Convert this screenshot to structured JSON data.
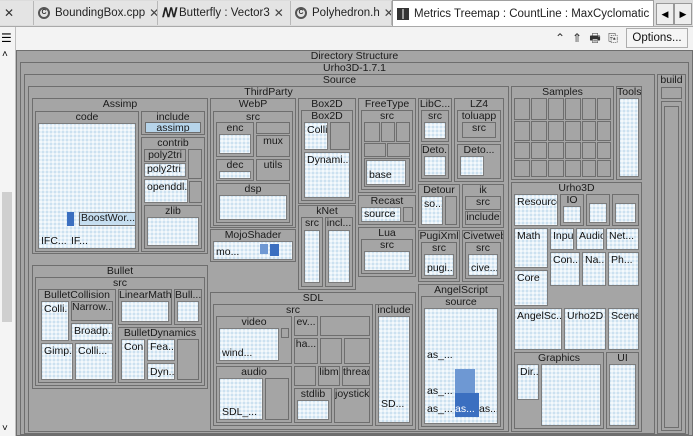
{
  "tabs": [
    {
      "label": "BoundingBox.cpp",
      "icon": "cpp-file-icon",
      "left": 0,
      "width": 34
    },
    {
      "label": "BoundingBox.cpp"
    },
    {
      "label": "Butterfly : Vector3"
    },
    {
      "label": "Polyhedron.h"
    },
    {
      "label": "Metrics Treemap : CountLine : MaxCyclomatic"
    }
  ],
  "toolbar": {
    "options_label": "Options..."
  },
  "treemap": {
    "root": "Directory Structure",
    "project": "Urho3D-1.7.1",
    "source": "Source",
    "thirdparty": "ThirdParty",
    "build": "build",
    "assimp": {
      "label": "Assimp",
      "code": "code",
      "include": "include",
      "assimp": "assimp",
      "contrib": "contrib",
      "poly2tri_a": "poly2tri",
      "poly2tri_b": "poly2tri",
      "openddl": "openddl...",
      "zlib": "zlib",
      "boostwor": "BoostWor...",
      "ifc1": "IFC...",
      "ifc2": "IF..."
    },
    "webp": {
      "label": "WebP",
      "src": "src",
      "enc": "enc",
      "mux": "mux",
      "dec": "dec",
      "utils": "utils",
      "dsp": "dsp"
    },
    "box2d": {
      "label": "Box2D",
      "inner": "Box2D",
      "colli": "Colli...",
      "dynami": "Dynami..."
    },
    "freetype": {
      "label": "FreeType",
      "src": "src",
      "base": "base"
    },
    "libc": {
      "label": "LibC...",
      "src": "src",
      "deto": "Deto..."
    },
    "lz4": {
      "label": "LZ4",
      "toluapp": "toluapp",
      "src": "src",
      "deto": "Deto..."
    },
    "recast": {
      "label": "Recast",
      "source": "source"
    },
    "detour": {
      "label": "Detour",
      "so": "so..."
    },
    "ik": {
      "label": "ik",
      "src": "src",
      "include": "include"
    },
    "knet": {
      "label": "kNet",
      "src": "src",
      "incl": "incl..."
    },
    "mojoshader": {
      "label": "MojoShader",
      "mo": "mo..."
    },
    "lua": {
      "label": "Lua",
      "src": "src"
    },
    "pugixml": {
      "label": "PugiXml",
      "src": "src",
      "pugi": "pugi..."
    },
    "civetweb": {
      "label": "Civetweb",
      "src": "src",
      "cive": "cive..."
    },
    "samples": {
      "label": "Samples"
    },
    "tools": {
      "label": "Tools"
    },
    "urho3d": {
      "label": "Urho3D",
      "resource": "Resource",
      "io": "IO",
      "math": "Math",
      "input": "Input",
      "audio": "Audio",
      "net": "Net...",
      "core": "Core",
      "con": "Con...",
      "na": "Na...",
      "ph": "Ph...",
      "angelsc": "AngelSc...",
      "urho2d": "Urho2D",
      "scene": "Scene",
      "graphics": "Graphics",
      "dir": "Dir...",
      "ui": "UI"
    },
    "bullet": {
      "label": "Bullet",
      "src": "src",
      "collision": "BulletCollision",
      "colli": "Colli...",
      "narrow": "Narrow...",
      "broadp": "Broadp...",
      "gimp": "Gimp...",
      "colli2": "Colli...",
      "linearmath": "LinearMath",
      "bull": "Bull...",
      "dynamics": "BulletDynamics",
      "con": "Con...",
      "fea": "Fea...",
      "dyn": "Dyn..."
    },
    "sdl": {
      "label": "SDL",
      "src": "src",
      "video": "video",
      "ev": "ev...",
      "wind": "wind...",
      "ha": "ha...",
      "audio": "audio",
      "sdl": "SDL_...",
      "libm": "libm",
      "thread": "thread",
      "stdlib": "stdlib",
      "joystick": "joystick",
      "include": "include",
      "sd": "SD..."
    },
    "angelscript": {
      "label": "AngelScript",
      "source": "source",
      "as1": "as_...",
      "as2": "as_...",
      "as3": "as_...",
      "as4": "as...",
      "as5": "as..."
    }
  }
}
